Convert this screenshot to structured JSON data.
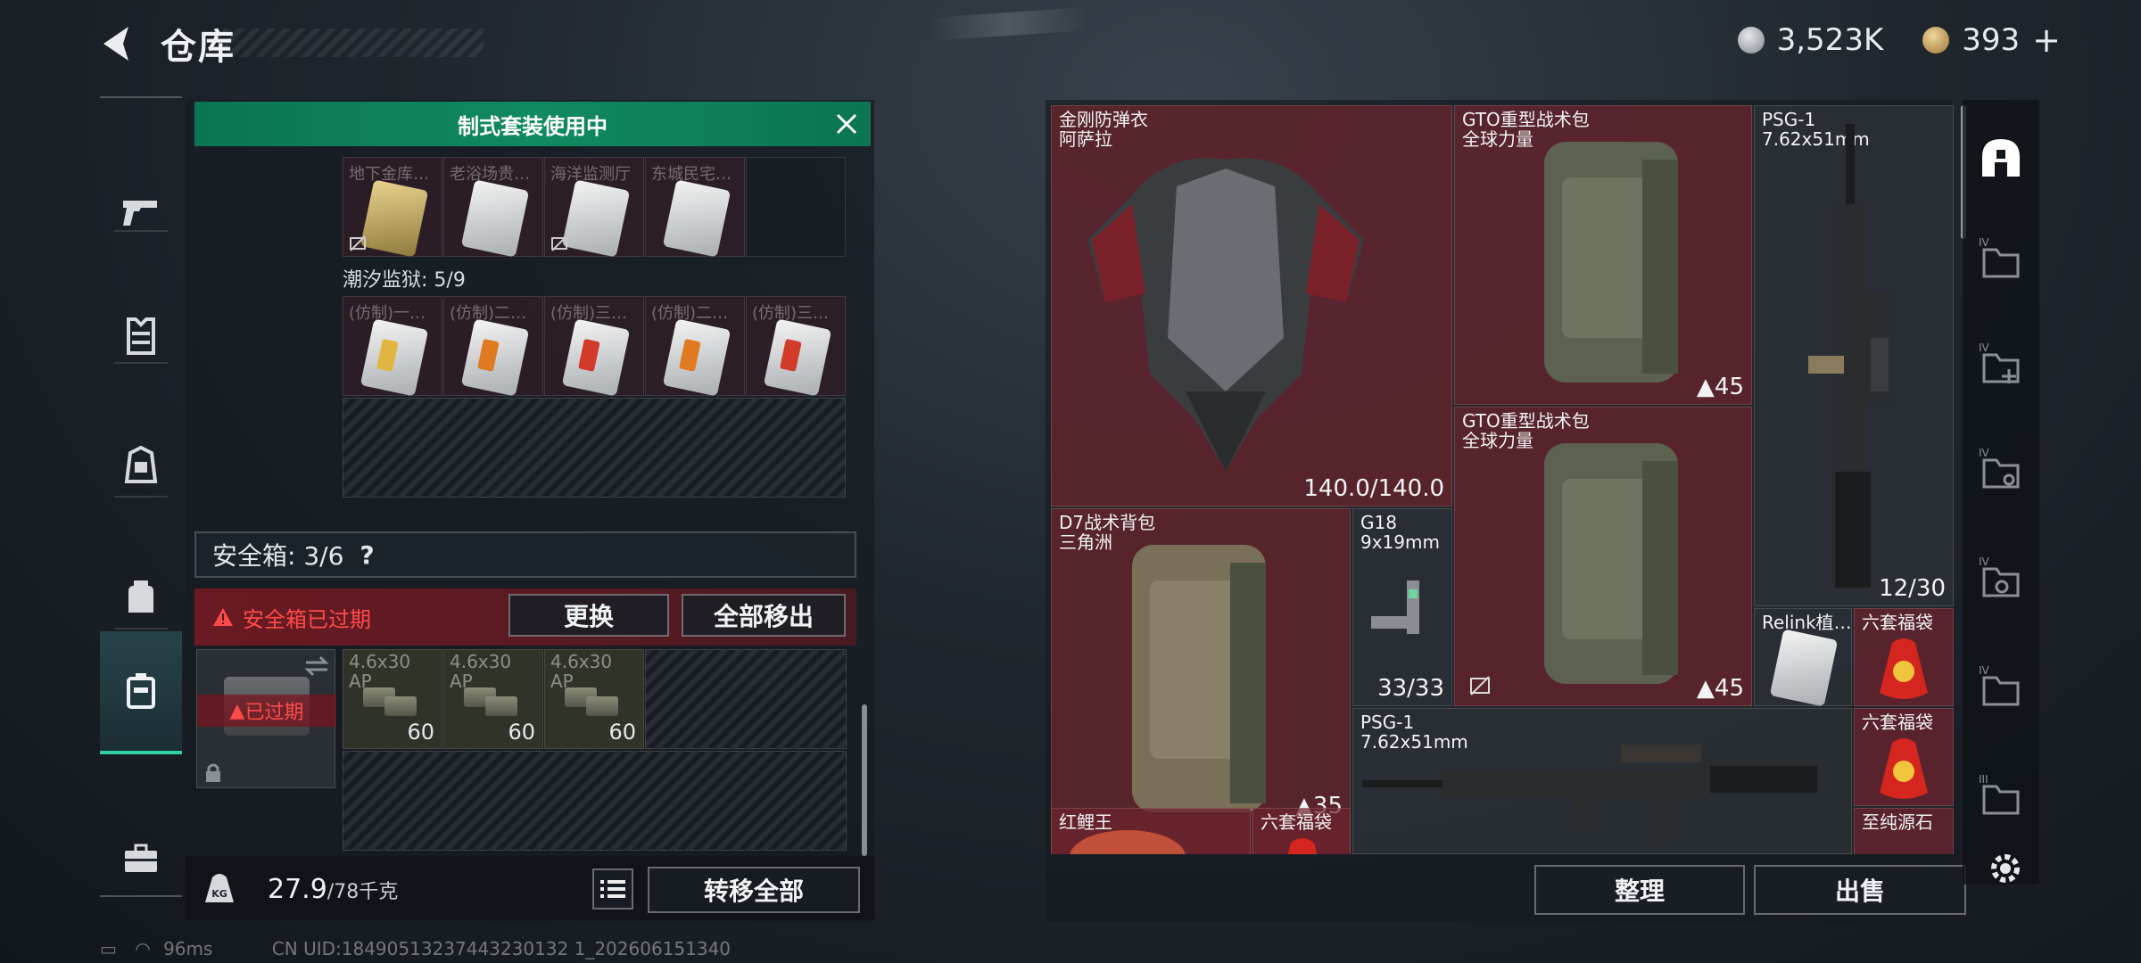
{
  "header": {
    "title": "仓库",
    "silver_amount": "3,523K",
    "gold_amount": "393",
    "gold_plus": "+"
  },
  "sidenav": {
    "items": [
      "weapon-icon",
      "armor-vest-icon",
      "backpack-icon",
      "rig-icon",
      "safe-box-icon",
      "toolbox-icon"
    ],
    "active_index": 4
  },
  "left_panel": {
    "banner": "制式套装使用中",
    "top_slots": [
      "地下金库…",
      "老浴场贵…",
      "海洋监测厅",
      "东城民宅…"
    ],
    "section_label": "潮汐监狱: 5/9",
    "prison_slots": [
      "(仿制)一…",
      "(仿制)二…",
      "(仿制)三…",
      "(仿制)二…",
      "(仿制)三…"
    ],
    "safe_box_label": "安全箱: 3/6",
    "safe_box_help": "?",
    "expired_text": "安全箱已过期",
    "replace_button": "更换",
    "move_all_out_button": "全部移出",
    "expired_badge": "已过期",
    "ammo": [
      {
        "name": "4.6x30",
        "sub": "AP",
        "count": "60"
      },
      {
        "name": "4.6x30",
        "sub": "AP",
        "count": "60"
      },
      {
        "name": "4.6x30",
        "sub": "AP",
        "count": "60"
      }
    ],
    "weight_value": "27.9",
    "weight_max": "/78千克",
    "transfer_all_button": "转移全部"
  },
  "inventory": {
    "items": [
      {
        "name": "金刚防弹衣",
        "sub": "阿萨拉",
        "value": "140.0/140.0"
      },
      {
        "name": "GTO重型战术包",
        "sub": "全球力量",
        "value": "45"
      },
      {
        "name": "PSG-1",
        "sub": "7.62x51mm",
        "value": "12/30"
      },
      {
        "name": "GTO重型战术包",
        "sub": "全球力量",
        "value": "45"
      },
      {
        "name": "D7战术背包",
        "sub": "三角洲",
        "value": "35"
      },
      {
        "name": "G18",
        "sub": "9x19mm",
        "value": "33/33"
      },
      {
        "name": "Relink植…",
        "sub": "",
        "value": ""
      },
      {
        "name": "六套福袋",
        "sub": "",
        "value": ""
      },
      {
        "name": "六套福袋",
        "sub": "",
        "value": ""
      },
      {
        "name": "PSG-1",
        "sub": "7.62x51mm",
        "value": ""
      },
      {
        "name": "红鲤王",
        "sub": "",
        "value": ""
      },
      {
        "name": "六套福袋",
        "sub": "",
        "value": ""
      },
      {
        "name": "至纯源石",
        "sub": "",
        "value": ""
      }
    ],
    "sort_button": "整理",
    "sell_button": "出售"
  },
  "status": {
    "ping": "96ms",
    "uid": "CN UID:18490513237443230132 1_202606151340"
  },
  "colors": {
    "accent": "#2fd0a4",
    "banner": "#108a60",
    "warning": "#ff4a4a",
    "item_red": "#6e222c"
  }
}
